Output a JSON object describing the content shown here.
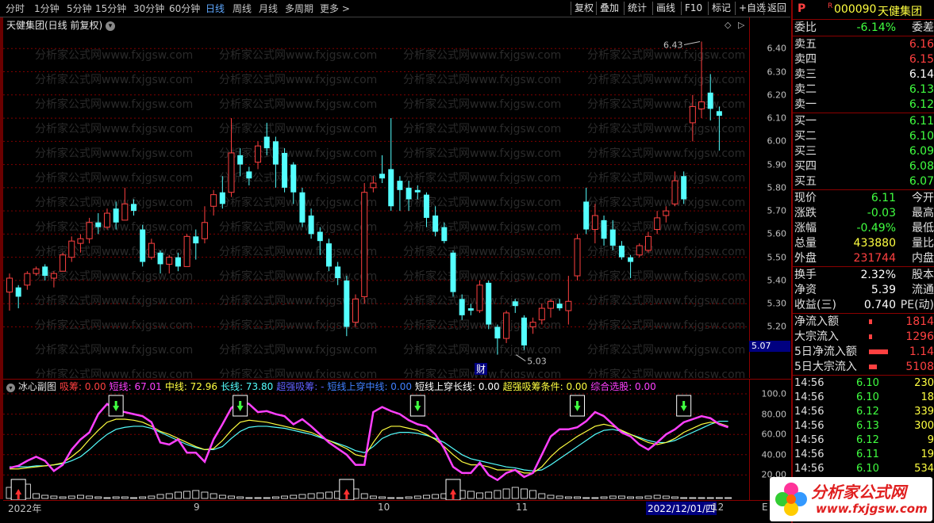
{
  "toolbar": {
    "periods": [
      "分时",
      "1分钟",
      "5分钟",
      "15分钟",
      "30分钟",
      "60分钟",
      "日线",
      "周线",
      "月线",
      "多周期",
      "更多 >"
    ],
    "active": "日线",
    "buttons": [
      "复权",
      "叠加",
      "统计",
      "画线",
      "F10",
      "标记",
      "+自选",
      "返回"
    ]
  },
  "chart": {
    "title": "天健集团(日线 前复权)",
    "high_label": "6.43",
    "low_label": "5.03",
    "cai_label": "财",
    "current_price": "5.07",
    "price_ticks": [
      "6.40",
      "6.30",
      "6.20",
      "6.10",
      "6.00",
      "5.90",
      "5.80",
      "5.70",
      "5.60",
      "5.50",
      "5.40",
      "5.30",
      "5.20"
    ],
    "watermark": "分析家公式网www.fxjgsw.com",
    "colors": {
      "up": "#ff4040",
      "down": "#54ffff",
      "grid": "#800000"
    }
  },
  "chart_data": {
    "type": "candlestick",
    "ylim": [
      5.0,
      6.5
    ],
    "candles": [
      {
        "o": 5.35,
        "c": 5.41,
        "h": 5.43,
        "l": 5.27
      },
      {
        "o": 5.37,
        "c": 5.33,
        "h": 5.38,
        "l": 5.28
      },
      {
        "o": 5.38,
        "c": 5.43,
        "h": 5.44,
        "l": 5.36
      },
      {
        "o": 5.43,
        "c": 5.45,
        "h": 5.46,
        "l": 5.42
      },
      {
        "o": 5.46,
        "c": 5.42,
        "h": 5.47,
        "l": 5.4
      },
      {
        "o": 5.41,
        "c": 5.43,
        "h": 5.44,
        "l": 5.37
      },
      {
        "o": 5.44,
        "c": 5.51,
        "h": 5.52,
        "l": 5.44
      },
      {
        "o": 5.5,
        "c": 5.57,
        "h": 5.59,
        "l": 5.48
      },
      {
        "o": 5.56,
        "c": 5.58,
        "h": 5.6,
        "l": 5.52
      },
      {
        "o": 5.58,
        "c": 5.65,
        "h": 5.67,
        "l": 5.56
      },
      {
        "o": 5.65,
        "c": 5.63,
        "h": 5.69,
        "l": 5.6
      },
      {
        "o": 5.63,
        "c": 5.69,
        "h": 5.71,
        "l": 5.62
      },
      {
        "o": 5.71,
        "c": 5.65,
        "h": 5.74,
        "l": 5.62
      },
      {
        "o": 5.66,
        "c": 5.73,
        "h": 5.8,
        "l": 5.66
      },
      {
        "o": 5.73,
        "c": 5.7,
        "h": 5.75,
        "l": 5.68
      },
      {
        "o": 5.62,
        "c": 5.48,
        "h": 5.64,
        "l": 5.46
      },
      {
        "o": 5.5,
        "c": 5.56,
        "h": 5.58,
        "l": 5.49
      },
      {
        "o": 5.52,
        "c": 5.47,
        "h": 5.53,
        "l": 5.43
      },
      {
        "o": 5.47,
        "c": 5.5,
        "h": 5.51,
        "l": 5.43
      },
      {
        "o": 5.5,
        "c": 5.46,
        "h": 5.52,
        "l": 5.44
      },
      {
        "o": 5.46,
        "c": 5.59,
        "h": 5.6,
        "l": 5.46
      },
      {
        "o": 5.59,
        "c": 5.56,
        "h": 5.62,
        "l": 5.49
      },
      {
        "o": 5.58,
        "c": 5.65,
        "h": 5.72,
        "l": 5.56
      },
      {
        "o": 5.72,
        "c": 5.77,
        "h": 5.79,
        "l": 5.68
      },
      {
        "o": 5.78,
        "c": 5.73,
        "h": 5.85,
        "l": 5.71
      },
      {
        "o": 5.78,
        "c": 5.95,
        "h": 6.1,
        "l": 5.76
      },
      {
        "o": 5.94,
        "c": 5.9,
        "h": 5.97,
        "l": 5.85
      },
      {
        "o": 5.87,
        "c": 5.84,
        "h": 5.89,
        "l": 5.81
      },
      {
        "o": 5.91,
        "c": 5.98,
        "h": 6.0,
        "l": 5.88
      },
      {
        "o": 6.02,
        "c": 5.97,
        "h": 6.08,
        "l": 5.94
      },
      {
        "o": 6.0,
        "c": 5.9,
        "h": 6.02,
        "l": 5.8
      },
      {
        "o": 5.95,
        "c": 5.8,
        "h": 5.97,
        "l": 5.78
      },
      {
        "o": 5.9,
        "c": 5.78,
        "h": 5.91,
        "l": 5.73
      },
      {
        "o": 5.78,
        "c": 5.65,
        "h": 5.8,
        "l": 5.63
      },
      {
        "o": 5.68,
        "c": 5.6,
        "h": 5.71,
        "l": 5.58
      },
      {
        "o": 5.61,
        "c": 5.57,
        "h": 5.63,
        "l": 5.51
      },
      {
        "o": 5.56,
        "c": 5.46,
        "h": 5.58,
        "l": 5.44
      },
      {
        "o": 5.46,
        "c": 5.41,
        "h": 5.48,
        "l": 5.38
      },
      {
        "o": 5.4,
        "c": 5.2,
        "h": 5.42,
        "l": 5.16
      },
      {
        "o": 5.22,
        "c": 5.32,
        "h": 5.34,
        "l": 5.2
      },
      {
        "o": 5.33,
        "c": 5.78,
        "h": 5.82,
        "l": 5.3
      },
      {
        "o": 5.8,
        "c": 5.82,
        "h": 5.85,
        "l": 5.78
      },
      {
        "o": 5.86,
        "c": 5.84,
        "h": 5.94,
        "l": 5.82
      },
      {
        "o": 5.88,
        "c": 5.72,
        "h": 6.1,
        "l": 5.7
      },
      {
        "o": 5.83,
        "c": 5.79,
        "h": 5.85,
        "l": 5.7
      },
      {
        "o": 5.8,
        "c": 5.75,
        "h": 5.83,
        "l": 5.7
      },
      {
        "o": 5.79,
        "c": 5.78,
        "h": 5.81,
        "l": 5.75
      },
      {
        "o": 5.77,
        "c": 5.67,
        "h": 5.78,
        "l": 5.63
      },
      {
        "o": 5.68,
        "c": 5.61,
        "h": 5.72,
        "l": 5.59
      },
      {
        "o": 5.63,
        "c": 5.57,
        "h": 5.65,
        "l": 5.56
      },
      {
        "o": 5.52,
        "c": 5.35,
        "h": 5.53,
        "l": 5.33
      },
      {
        "o": 5.32,
        "c": 5.25,
        "h": 5.34,
        "l": 5.23
      },
      {
        "o": 5.28,
        "c": 5.27,
        "h": 5.3,
        "l": 5.25
      },
      {
        "o": 5.27,
        "c": 5.38,
        "h": 5.4,
        "l": 5.26
      },
      {
        "o": 5.39,
        "c": 5.21,
        "h": 5.4,
        "l": 5.19
      },
      {
        "o": 5.2,
        "c": 5.15,
        "h": 5.21,
        "l": 5.08
      },
      {
        "o": 5.15,
        "c": 5.26,
        "h": 5.27,
        "l": 5.13
      },
      {
        "o": 5.31,
        "c": 5.29,
        "h": 5.32,
        "l": 5.26
      },
      {
        "o": 5.24,
        "c": 5.12,
        "h": 5.25,
        "l": 5.1
      },
      {
        "o": 5.2,
        "c": 5.22,
        "h": 5.24,
        "l": 5.17
      },
      {
        "o": 5.23,
        "c": 5.28,
        "h": 5.3,
        "l": 5.21
      },
      {
        "o": 5.28,
        "c": 5.31,
        "h": 5.32,
        "l": 5.24
      },
      {
        "o": 5.3,
        "c": 5.28,
        "h": 5.32,
        "l": 5.27
      },
      {
        "o": 5.27,
        "c": 5.31,
        "h": 5.42,
        "l": 5.21
      },
      {
        "o": 5.42,
        "c": 5.58,
        "h": 5.6,
        "l": 5.4
      },
      {
        "o": 5.74,
        "c": 5.62,
        "h": 5.8,
        "l": 5.6
      },
      {
        "o": 5.62,
        "c": 5.68,
        "h": 5.73,
        "l": 5.56
      },
      {
        "o": 5.66,
        "c": 5.58,
        "h": 5.68,
        "l": 5.55
      },
      {
        "o": 5.62,
        "c": 5.55,
        "h": 5.66,
        "l": 5.53
      },
      {
        "o": 5.55,
        "c": 5.5,
        "h": 5.57,
        "l": 5.49
      },
      {
        "o": 5.5,
        "c": 5.48,
        "h": 5.51,
        "l": 5.41
      },
      {
        "o": 5.51,
        "c": 5.55,
        "h": 5.56,
        "l": 5.5
      },
      {
        "o": 5.53,
        "c": 5.59,
        "h": 5.61,
        "l": 5.52
      },
      {
        "o": 5.62,
        "c": 5.67,
        "h": 5.7,
        "l": 5.6
      },
      {
        "o": 5.68,
        "c": 5.7,
        "h": 5.72,
        "l": 5.65
      },
      {
        "o": 5.73,
        "c": 5.83,
        "h": 5.87,
        "l": 5.72
      },
      {
        "o": 5.85,
        "c": 5.75,
        "h": 5.87,
        "l": 5.73
      },
      {
        "o": 6.08,
        "c": 6.15,
        "h": 6.2,
        "l": 6.0
      },
      {
        "o": 6.14,
        "c": 6.17,
        "h": 6.43,
        "l": 6.1
      },
      {
        "o": 6.21,
        "c": 6.14,
        "h": 6.29,
        "l": 6.09
      },
      {
        "o": 6.13,
        "c": 6.11,
        "h": 6.15,
        "l": 5.96
      }
    ]
  },
  "indicator": {
    "name": "冰心副图",
    "legend": [
      {
        "label": "吸筹: 0.00",
        "color": "#ff4040"
      },
      {
        "label": "短线: 67.01",
        "color": "#ff40ff"
      },
      {
        "label": "中线: 72.96",
        "color": "#ffff40"
      },
      {
        "label": "长线: 73.80",
        "color": "#54ffff"
      },
      {
        "label": "超强吸筹: -",
        "color": "#6060ff"
      },
      {
        "label": "短线上穿中线: 0.00",
        "color": "#4080ff"
      },
      {
        "label": "短线上穿长线: 0.00",
        "color": "#ffffff"
      },
      {
        "label": "超强吸筹条件: 0.00",
        "color": "#ffff40"
      },
      {
        "label": "综合选股: 0.00",
        "color": "#ff40ff"
      }
    ],
    "ticks": [
      "100.0",
      "80.00",
      "60.00",
      "40.00",
      "20.00"
    ],
    "ylim": [
      0,
      100
    ],
    "short": [
      27,
      29,
      34,
      38,
      34,
      24,
      30,
      45,
      55,
      62,
      80,
      90,
      84,
      82,
      80,
      78,
      72,
      52,
      50,
      55,
      42,
      42,
      33,
      55,
      70,
      86,
      93,
      90,
      82,
      83,
      80,
      78,
      70,
      75,
      68,
      60,
      52,
      46,
      40,
      30,
      30,
      82,
      87,
      83,
      80,
      74,
      70,
      68,
      60,
      46,
      28,
      22,
      22,
      32,
      20,
      15,
      22,
      25,
      18,
      22,
      40,
      58,
      65,
      65,
      67,
      73,
      82,
      78,
      70,
      62,
      58,
      50,
      45,
      52,
      60,
      65,
      72,
      75,
      78,
      76,
      70,
      67
    ],
    "mid": [
      26,
      26,
      27,
      28,
      29,
      30,
      32,
      38,
      45,
      55,
      64,
      72,
      75,
      75,
      74,
      72,
      68,
      63,
      60,
      56,
      52,
      48,
      45,
      46,
      54,
      64,
      72,
      74,
      73,
      72,
      70,
      68,
      66,
      64,
      62,
      58,
      54,
      50,
      46,
      40,
      38,
      52,
      64,
      68,
      68,
      66,
      64,
      60,
      55,
      48,
      40,
      33,
      30,
      30,
      28,
      25,
      25,
      25,
      22,
      22,
      28,
      38,
      46,
      52,
      58,
      63,
      68,
      70,
      68,
      64,
      60,
      56,
      52,
      50,
      52,
      56,
      62,
      66,
      70,
      72,
      71,
      68
    ],
    "long": [
      28,
      28,
      28,
      29,
      29,
      30,
      31,
      34,
      38,
      45,
      53,
      60,
      65,
      67,
      68,
      68,
      66,
      62,
      58,
      54,
      50,
      47,
      45,
      45,
      48,
      56,
      63,
      67,
      68,
      68,
      67,
      66,
      64,
      62,
      60,
      57,
      54,
      51,
      48,
      44,
      42,
      48,
      56,
      60,
      62,
      62,
      61,
      59,
      56,
      52,
      46,
      40,
      36,
      34,
      32,
      30,
      28,
      27,
      25,
      24,
      25,
      30,
      36,
      42,
      48,
      54,
      60,
      64,
      65,
      63,
      60,
      57,
      54,
      52,
      52,
      54,
      58,
      62,
      66,
      70,
      73,
      73
    ],
    "sell_marks": [
      12,
      26,
      46,
      64,
      76
    ],
    "buy_marks": [
      1,
      38,
      50
    ]
  },
  "dateaxis": {
    "labels": [
      "2022年",
      "9",
      "10",
      "11",
      "2022/12/01/四",
      "12"
    ],
    "corner": "E"
  },
  "quote": {
    "symbol_prefix": "P",
    "r_mark": "R",
    "code": "000090",
    "name": "天健集团",
    "weibi": {
      "label": "委比",
      "value": "-6.14%",
      "label2": "委差"
    },
    "asks": [
      {
        "label": "卖五",
        "value": "6.16",
        "cls": "up"
      },
      {
        "label": "卖四",
        "value": "6.15",
        "cls": "up"
      },
      {
        "label": "卖三",
        "value": "6.14",
        "cls": "wh"
      },
      {
        "label": "卖二",
        "value": "6.13",
        "cls": "dn"
      },
      {
        "label": "卖一",
        "value": "6.12",
        "cls": "dn"
      }
    ],
    "bids": [
      {
        "label": "买一",
        "value": "6.11",
        "cls": "dn"
      },
      {
        "label": "买二",
        "value": "6.10",
        "cls": "dn"
      },
      {
        "label": "买三",
        "value": "6.09",
        "cls": "dn"
      },
      {
        "label": "买四",
        "value": "6.08",
        "cls": "dn"
      },
      {
        "label": "买五",
        "value": "6.07",
        "cls": "dn"
      }
    ],
    "stats1": [
      {
        "label": "现价",
        "value": "6.11",
        "cls": "dn",
        "label2": "今开"
      },
      {
        "label": "涨跌",
        "value": "-0.03",
        "cls": "dn",
        "label2": "最高"
      },
      {
        "label": "涨幅",
        "value": "-0.49%",
        "cls": "dn",
        "label2": "最低"
      },
      {
        "label": "总量",
        "value": "433880",
        "cls": "yl",
        "label2": "量比"
      },
      {
        "label": "外盘",
        "value": "231744",
        "cls": "up",
        "label2": "内盘"
      }
    ],
    "stats2": [
      {
        "label": "换手",
        "value": "2.32%",
        "cls": "wh",
        "label2": "股本"
      },
      {
        "label": "净资",
        "value": "5.39",
        "cls": "wh",
        "label2": "流通"
      },
      {
        "label": "收益(三)",
        "value": "0.740",
        "cls": "wh",
        "label2": "PE(动)"
      }
    ],
    "flows": [
      {
        "label": "净流入额",
        "value": "1814",
        "bar": 4
      },
      {
        "label": "大宗流入",
        "value": "1296",
        "bar": 4
      },
      {
        "label": "5日净流入额",
        "value": "1.14",
        "bar": 24
      },
      {
        "label": "5日大宗流入",
        "value": "5108",
        "bar": 10
      }
    ],
    "ticks": [
      {
        "time": "14:56",
        "price": "6.10",
        "vol": "230"
      },
      {
        "time": "14:56",
        "price": "6.10",
        "vol": "18"
      },
      {
        "time": "14:56",
        "price": "6.12",
        "vol": "339"
      },
      {
        "time": "14:56",
        "price": "6.13",
        "vol": "300"
      },
      {
        "time": "14:56",
        "price": "6.12",
        "vol": "9"
      },
      {
        "time": "14:56",
        "price": "6.11",
        "vol": "19"
      },
      {
        "time": "14:56",
        "price": "6.10",
        "vol": "534"
      }
    ]
  },
  "logo": {
    "text": "分析家公式网",
    "url": "www.fxjgsw.com"
  }
}
